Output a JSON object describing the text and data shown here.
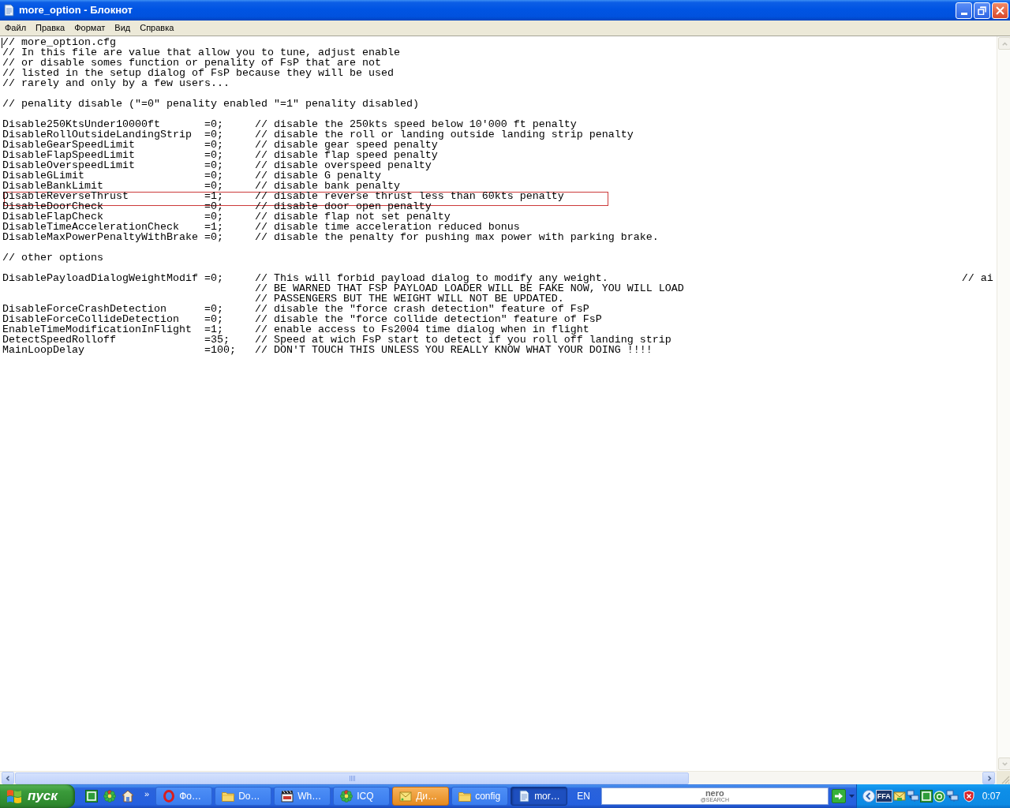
{
  "window": {
    "title": "more_option - Блокнот"
  },
  "menu": [
    "Файл",
    "Правка",
    "Формат",
    "Вид",
    "Справка"
  ],
  "document": {
    "blocks": [
      {
        "lines": [
          {
            "kind": "comment",
            "text": "// more_option.cfg",
            "boxed": false
          },
          {
            "kind": "comment",
            "text": "// In this file are value that allow you to tune, adjust enable",
            "boxed": false
          },
          {
            "kind": "comment",
            "text": "// or disable somes function or penality of FsP that are not",
            "boxed": false
          },
          {
            "kind": "comment",
            "text": "// listed in the setup dialog of FsP because they will be used",
            "boxed": false
          },
          {
            "kind": "comment",
            "text": "// rarely and only by a few users...",
            "boxed": false
          }
        ]
      },
      {
        "lines": [
          {
            "kind": "comment",
            "text": "// penality disable (\"=0\" penality enabled \"=1\" penality disabled)",
            "boxed": false
          }
        ]
      },
      {
        "lines": [
          {
            "kind": "setting",
            "key": "Disable250KtsUnder10000ft",
            "value": "=0;",
            "comment": "// disable the 250kts speed below 10'000 ft penalty",
            "boxed": false
          },
          {
            "kind": "setting",
            "key": "DisableRollOutsideLandingStrip",
            "value": "=0;",
            "comment": "// disable the roll or landing outside landing strip penalty",
            "boxed": false
          },
          {
            "kind": "setting",
            "key": "DisableGearSpeedLimit",
            "value": "=0;",
            "comment": "// disable gear speed penalty",
            "boxed": false
          },
          {
            "kind": "setting",
            "key": "DisableFlapSpeedLimit",
            "value": "=0;",
            "comment": "// disable flap speed penalty",
            "boxed": false
          },
          {
            "kind": "setting",
            "key": "DisableOverspeedLimit",
            "value": "=0;",
            "comment": "// disable overspeed penalty",
            "boxed": false
          },
          {
            "kind": "setting",
            "key": "DisableGLimit",
            "value": "=0;",
            "comment": "// disable G penalty",
            "boxed": false
          },
          {
            "kind": "setting",
            "key": "DisableBankLimit",
            "value": "=0;",
            "comment": "// disable bank penalty",
            "boxed": false
          },
          {
            "kind": "setting",
            "key": "DisableReverseThrust",
            "value": "=1;",
            "comment": "// disable reverse thrust less than 60kts penalty",
            "boxed": true
          },
          {
            "kind": "setting",
            "key": "DisableDoorCheck",
            "value": "=0;",
            "comment": "// disable door open penalty",
            "boxed": false
          },
          {
            "kind": "setting",
            "key": "DisableFlapCheck",
            "value": "=0;",
            "comment": "// disable flap not set penalty",
            "boxed": false
          },
          {
            "kind": "setting",
            "key": "DisableTimeAccelerationCheck",
            "value": "=1;",
            "comment": "// disable time acceleration reduced bonus",
            "boxed": false
          },
          {
            "kind": "setting",
            "key": "DisableMaxPowerPenaltyWithBrake",
            "value": "=0;",
            "comment": "// disable the penalty for pushing max power with parking brake.",
            "boxed": false
          }
        ]
      },
      {
        "lines": [
          {
            "kind": "comment",
            "text": "// other options",
            "boxed": false
          }
        ]
      },
      {
        "lines": [
          {
            "kind": "setting",
            "key": "DisablePayloadDialogWeightModif",
            "value": "=0;",
            "comment": "// This will forbid payload dialog to modify any weight.",
            "comment_2": "// ai",
            "boxed": false
          },
          {
            "kind": "continuation",
            "comment": "// BE WARNED THAT FSP PAYLOAD LOADER WILL BE FAKE NOW, YOU WILL LOAD",
            "boxed": false
          },
          {
            "kind": "continuation",
            "comment": "// PASSENGERS BUT THE WEIGHT WILL NOT BE UPDATED.",
            "boxed": false
          },
          {
            "kind": "setting",
            "key": "DisableForceCrashDetection",
            "value": "=0;",
            "comment": "// disable the \"force crash detection\" feature of FsP",
            "boxed": false
          },
          {
            "kind": "setting",
            "key": "DisableForceCollideDetection",
            "value": "=0;",
            "comment": "// disable the \"force collide detection\" feature of FsP",
            "boxed": false
          },
          {
            "kind": "setting",
            "key": "EnableTimeModificationInFlight",
            "value": "=1;",
            "comment": "// enable access to Fs2004 time dialog when in flight",
            "boxed": false
          },
          {
            "kind": "setting",
            "key": "DetectSpeedRolloff",
            "value": "=35;",
            "comment": "// Speed at wich FsP start to detect if you roll off landing strip",
            "boxed": false
          },
          {
            "kind": "setting",
            "key": "MainLoopDelay",
            "value": "=100;",
            "comment": "// DON'T TOUCH THIS UNLESS YOU REALLY KNOW WHAT YOUR DOING !!!!",
            "boxed": false
          }
        ]
      }
    ]
  },
  "taskbar": {
    "start_label": "пуск",
    "quick_launch_more": "»",
    "buttons": [
      {
        "kind": "browser",
        "label": "Фо…",
        "selected": false,
        "flashing": false
      },
      {
        "kind": "folder",
        "label": "Do…",
        "selected": false,
        "flashing": false
      },
      {
        "kind": "player",
        "label": "Wh…",
        "selected": false,
        "flashing": false
      },
      {
        "kind": "messenger",
        "label": "ICQ",
        "selected": false,
        "flashing": false
      },
      {
        "kind": "note",
        "label": "Ди…",
        "selected": false,
        "flashing": true
      },
      {
        "kind": "folder",
        "label": "config",
        "selected": false,
        "flashing": false
      },
      {
        "kind": "notepad",
        "label": "mor…",
        "selected": true,
        "flashing": false
      }
    ],
    "language": "EN",
    "search_logo": {
      "top": "nero",
      "bottom": "@SEARCH"
    },
    "tray_badge": "FFA",
    "clock": "0:07"
  }
}
